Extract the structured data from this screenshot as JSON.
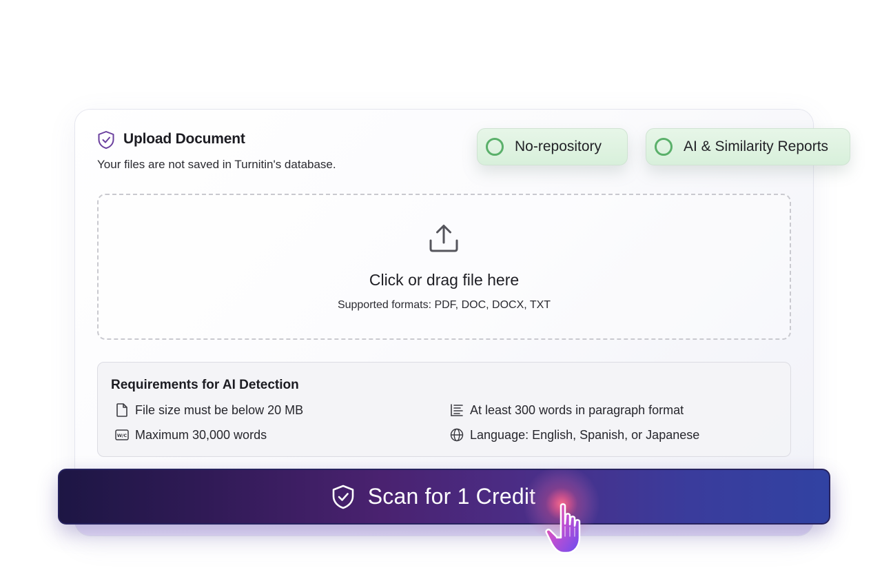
{
  "upload": {
    "icon": "shield-check-icon",
    "title": "Upload Document",
    "subtitle": "Your files are not saved in Turnitin's database."
  },
  "badges": [
    {
      "label": "No-repository",
      "icon": "circle-icon",
      "color": "#5ab06a"
    },
    {
      "label": "AI & Similarity Reports",
      "icon": "circle-icon",
      "color": "#5ab06a"
    }
  ],
  "dropzone": {
    "icon": "upload-icon",
    "title": "Click or drag file here",
    "formats": "Supported formats: PDF, DOC, DOCX, TXT"
  },
  "requirements": {
    "title": "Requirements for AI Detection",
    "items": [
      {
        "icon": "file-icon",
        "text": "File size must be below 20 MB"
      },
      {
        "icon": "word-count-icon",
        "text": "Maximum 30,000 words"
      },
      {
        "icon": "paragraph-icon",
        "text": "At least 300 words in paragraph format"
      },
      {
        "icon": "globe-icon",
        "text": "Language: English, Spanish, or Japanese"
      }
    ]
  },
  "scan_button": {
    "icon": "shield-check-icon",
    "label": "Scan for 1 Credit",
    "gradient": [
      "#1d1644",
      "#4a2270",
      "#3142a2"
    ]
  },
  "cursor": {
    "icon": "hand-pointer-icon"
  },
  "colors": {
    "badge_bg": "#dff3e1",
    "badge_ring": "#5ab06a",
    "brand_purple": "#6b3fa0"
  }
}
